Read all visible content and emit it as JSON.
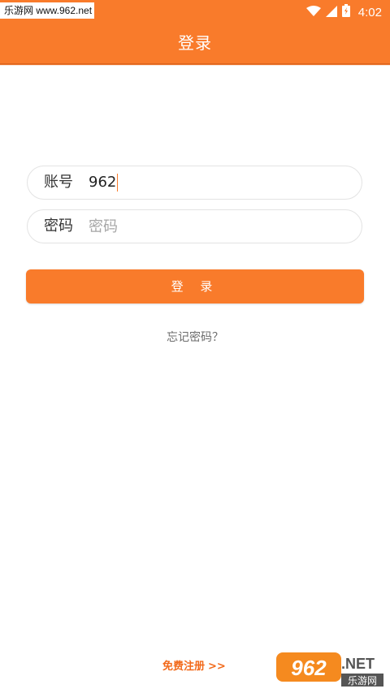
{
  "watermark": {
    "site_text": "乐游网 www.962.net",
    "logo_text": "962.NET",
    "logo_subtext": "乐游网"
  },
  "status_bar": {
    "time": "4:02",
    "icons": [
      "wifi-icon",
      "signal-icon",
      "battery-icon"
    ]
  },
  "header": {
    "title": "登录"
  },
  "form": {
    "account_label": "账号",
    "account_value": "962",
    "password_label": "密码",
    "password_placeholder": "密码"
  },
  "login_button_label": "登 录",
  "forgot_password_link": "忘记密码？",
  "register_link": {
    "label": "免费注册",
    "arrow": ">>"
  },
  "colors": {
    "accent": "#f97b2b",
    "input_border": "#e3e3e3",
    "muted_text": "#6b6b6b"
  }
}
